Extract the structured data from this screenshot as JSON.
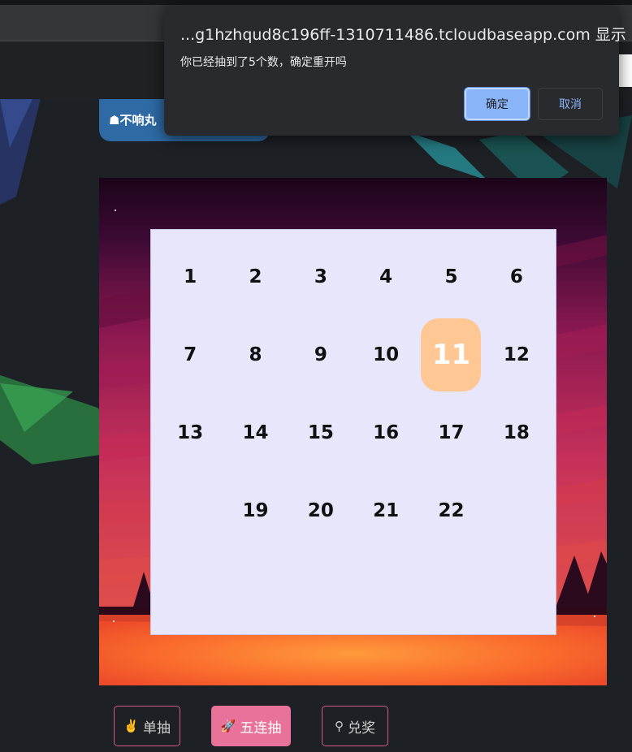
{
  "dialog": {
    "origin_text": "...g1hzhqud8c196ff-1310711486.tcloudbaseapp.com 显示",
    "message": "你已经抽到了5个数，确定重开吗",
    "ok_label": "确定",
    "cancel_label": "取消"
  },
  "banner": {
    "label": "不响丸"
  },
  "board": {
    "cells": [
      "1",
      "2",
      "3",
      "4",
      "5",
      "6",
      "7",
      "8",
      "9",
      "10",
      "11",
      "12",
      "13",
      "14",
      "15",
      "16",
      "17",
      "18",
      "",
      "19",
      "20",
      "21",
      "22",
      ""
    ],
    "highlighted": "11"
  },
  "actions": {
    "single_label": "单抽",
    "single_icon": "hand-peace-icon",
    "five_label": "五连抽",
    "five_icon": "rocket-icon",
    "redeem_label": "兑奖",
    "redeem_icon": "search-icon"
  },
  "colors": {
    "board_bg": "#e8e6fb",
    "highlight": "#fec793",
    "accent_pink": "#e8729a",
    "dialog_ok": "#8ab4f8"
  }
}
